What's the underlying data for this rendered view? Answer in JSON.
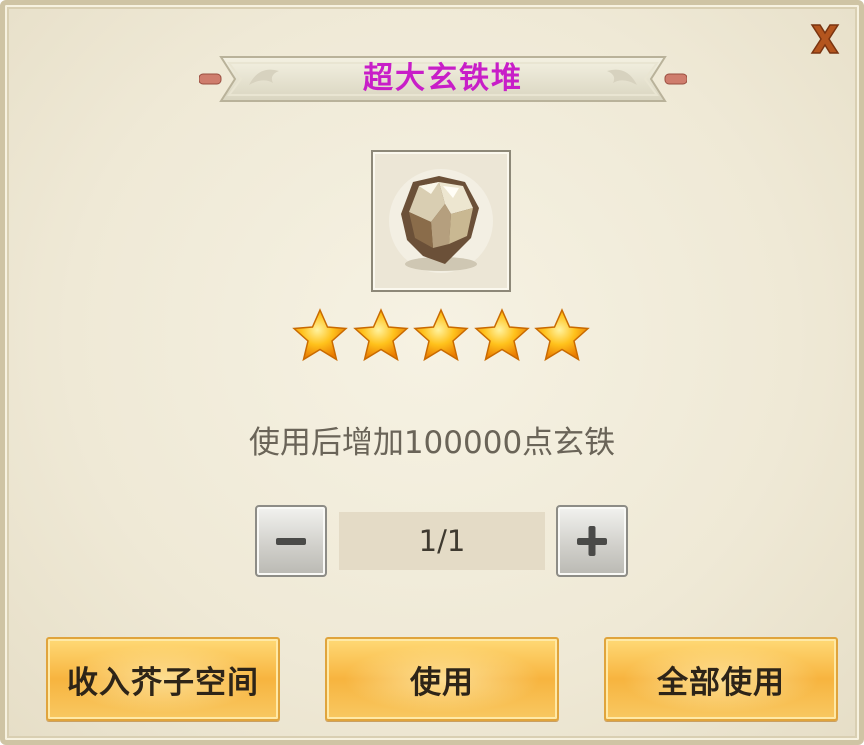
{
  "dialog": {
    "title": "超大玄铁堆",
    "close_icon": "close-x-icon",
    "item_icon": "iron-ore-icon",
    "star_rating": 5,
    "star_max": 5,
    "description": "使用后增加100000点玄铁",
    "quantity": {
      "decrement_icon": "minus-icon",
      "value": "1/1",
      "increment_icon": "plus-icon"
    },
    "buttons": {
      "store": "收入芥子空间",
      "use": "使用",
      "use_all": "全部使用"
    }
  },
  "colors": {
    "title": "#c81ec8",
    "button_gold": "#f7b43f",
    "close": "#b4551e"
  }
}
